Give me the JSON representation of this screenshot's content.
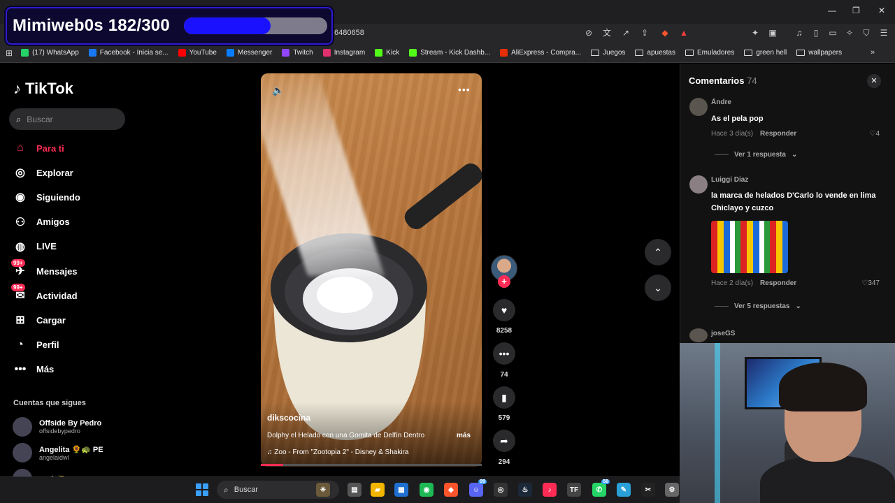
{
  "browser": {
    "url_fragment": "6480658",
    "bookmarks": [
      {
        "label": "(17) WhatsApp",
        "icon": "whatsapp-icon",
        "color": "#25d366"
      },
      {
        "label": "Facebook - Inicia se...",
        "icon": "facebook-icon",
        "color": "#1877f2"
      },
      {
        "label": "YouTube",
        "icon": "youtube-icon",
        "color": "#ff0000"
      },
      {
        "label": "Messenger",
        "icon": "messenger-icon",
        "color": "#0a7cff"
      },
      {
        "label": "Twitch",
        "icon": "twitch-icon",
        "color": "#9146ff"
      },
      {
        "label": "Instagram",
        "icon": "instagram-icon",
        "color": "#e1306c"
      },
      {
        "label": "Kick",
        "icon": "kick-icon",
        "color": "#53fc18"
      },
      {
        "label": "Stream - Kick Dashb...",
        "icon": "kick-icon",
        "color": "#53fc18"
      },
      {
        "label": "AliExpress - Compra...",
        "icon": "aliexpress-icon",
        "color": "#e62e04"
      },
      {
        "label": "Juegos",
        "icon": "folder-icon"
      },
      {
        "label": "apuestas",
        "icon": "folder-icon"
      },
      {
        "label": "Emuladores",
        "icon": "folder-icon"
      },
      {
        "label": "green hell",
        "icon": "folder-icon"
      },
      {
        "label": "wallpapers",
        "icon": "folder-icon"
      }
    ]
  },
  "overlay": {
    "title": "Mimiweb0s 182/300",
    "progress_fraction": 0.6067,
    "bar_color": "#1a12ff"
  },
  "sidebar": {
    "logo": "TikTok",
    "search_placeholder": "Buscar",
    "nav": [
      {
        "label": "Para ti",
        "icon": "home-icon",
        "active": true
      },
      {
        "label": "Explorar",
        "icon": "compass-icon"
      },
      {
        "label": "Siguiendo",
        "icon": "following-avatar-icon"
      },
      {
        "label": "Amigos",
        "icon": "friends-icon"
      },
      {
        "label": "LIVE",
        "icon": "live-icon"
      },
      {
        "label": "Mensajes",
        "icon": "messages-icon",
        "badge": "99+"
      },
      {
        "label": "Actividad",
        "icon": "activity-icon",
        "badge": "99+"
      },
      {
        "label": "Cargar",
        "icon": "upload-icon"
      },
      {
        "label": "Perfil",
        "icon": "profile-icon"
      },
      {
        "label": "Más",
        "icon": "more-icon"
      }
    ],
    "following_title": "Cuentas que sigues",
    "following": [
      {
        "name": "Offside By Pedro",
        "handle": "offsidebypedro"
      },
      {
        "name": "Angelita 🌻🐢 PE",
        "handle": "angelaidwl"
      },
      {
        "name": "paris🍋",
        "handle": ""
      }
    ]
  },
  "video": {
    "username": "dikscocina",
    "description": "Dolphy el Helado con una Gomita de Delfín Dentro",
    "more_label": "más",
    "music": "Zoo - From \"Zootopia 2\" - Disney & Shakira",
    "progress_fraction": 0.1
  },
  "actions": {
    "likes": "8258",
    "comments": "74",
    "saves": "579",
    "shares": "294"
  },
  "comments": {
    "title": "Comentarios",
    "count": "74",
    "reply_label": "Responder",
    "items": [
      {
        "user": "Ándre",
        "text": "As el pela pop",
        "time": "Hace 3 día(s)",
        "likes": "4",
        "more": "Ver 1 respuesta"
      },
      {
        "user": "Luiggi Diaz",
        "text": "la marca de helados D'Carlo lo vende en lima Chiclayo y cuzco",
        "time": "Hace 2 día(s)",
        "likes": "347",
        "more": "Ver 5 respuestas"
      },
      {
        "user": "joseGS"
      }
    ]
  },
  "taskbar": {
    "search_placeholder": "Buscar",
    "apps": [
      {
        "icon": "widgets-icon",
        "color": "#6b5a3a"
      },
      {
        "icon": "taskview-icon",
        "color": "#555"
      },
      {
        "icon": "file-explorer-icon",
        "color": "#f2b600"
      },
      {
        "icon": "store-icon",
        "color": "#1f6fd1"
      },
      {
        "icon": "spotify-icon",
        "color": "#1db954"
      },
      {
        "icon": "brave-icon",
        "color": "#fb542b"
      },
      {
        "icon": "discord-icon",
        "color": "#5865f2",
        "badge": "99"
      },
      {
        "icon": "obs-icon",
        "color": "#333"
      },
      {
        "icon": "steam-icon",
        "color": "#1b2838"
      },
      {
        "icon": "tiktok-icon",
        "color": "#fe2c55"
      },
      {
        "icon": "tf-icon",
        "color": "#444"
      },
      {
        "icon": "whatsapp-icon",
        "color": "#25d366",
        "badge": "58"
      },
      {
        "icon": "notepad-icon",
        "color": "#2aa0d8"
      },
      {
        "icon": "capcut-icon",
        "color": "#222"
      },
      {
        "icon": "settings-icon",
        "color": "#666"
      }
    ]
  }
}
